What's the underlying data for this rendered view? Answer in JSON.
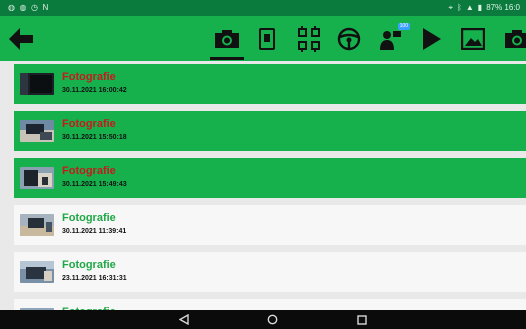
{
  "status_bar": {
    "left_text": "N",
    "right_text": "87% 16:0"
  },
  "toolbar": {
    "tools": [
      "camera-icon",
      "document-icon",
      "grid-icon",
      "steering-wheel-icon",
      "person-sign-icon",
      "play-icon",
      "image-icon",
      "camera-icon"
    ],
    "active_tool": "camera-icon",
    "badge_text": "100"
  },
  "list": {
    "items": [
      {
        "title": "Fotografie",
        "date": "30.11.2021 16:00:42",
        "selected": true
      },
      {
        "title": "Fotografie",
        "date": "30.11.2021 15:50:18",
        "selected": true
      },
      {
        "title": "Fotografie",
        "date": "30.11.2021 15:49:43",
        "selected": true
      },
      {
        "title": "Fotografie",
        "date": "30.11.2021 11:39:41",
        "selected": false
      },
      {
        "title": "Fotografie",
        "date": "23.11.2021 16:31:31",
        "selected": false
      },
      {
        "title": "Fotografie",
        "date": "",
        "selected": false
      }
    ]
  },
  "colors": {
    "toolbar": "#16b04d",
    "status_bar": "#0a7a3d",
    "selected_title": "#c51b1b",
    "normal_title": "#1ea845"
  }
}
